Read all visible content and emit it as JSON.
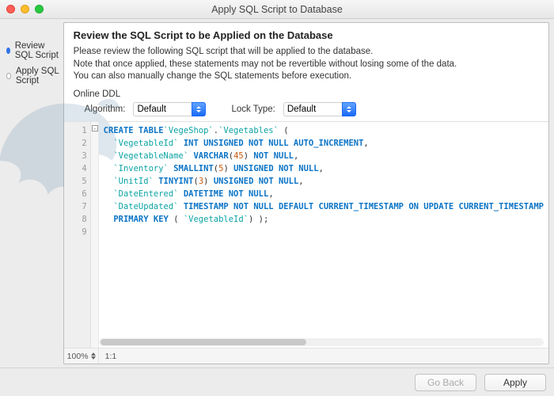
{
  "window": {
    "title": "Apply SQL Script to Database"
  },
  "sidebar": {
    "steps": [
      {
        "label": "Review SQL Script",
        "status": "active"
      },
      {
        "label": "Apply SQL Script",
        "status": "pending"
      }
    ]
  },
  "header": {
    "title": "Review the SQL Script to be Applied on the Database"
  },
  "description": {
    "line1": "Please review the following SQL script that will be applied to the database.",
    "line2": "Note that once applied, these statements may not be revertible without losing some of the data.",
    "line3": "You can also manually change the SQL statements before execution."
  },
  "ddl": {
    "section_label": "Online DDL",
    "algorithm_label": "Algorithm:",
    "algorithm_value": "Default",
    "lock_label": "Lock Type:",
    "lock_value": "Default"
  },
  "sql": {
    "lines": [
      {
        "n": 1,
        "tokens": [
          [
            "kw",
            "CREATE TABLE"
          ],
          [
            "",
            ""
          ],
          [
            "id",
            "`VegeShop`"
          ],
          [
            "",
            "."
          ],
          [
            "id",
            "`Vegetables`"
          ],
          [
            "",
            " ("
          ]
        ]
      },
      {
        "n": 2,
        "tokens": [
          [
            "",
            "  "
          ],
          [
            "id",
            "`VegetableId`"
          ],
          [
            "",
            " "
          ],
          [
            "ty",
            "INT UNSIGNED NOT NULL AUTO_INCREMENT"
          ],
          [
            "",
            ","
          ]
        ]
      },
      {
        "n": 3,
        "tokens": [
          [
            "",
            "  "
          ],
          [
            "id",
            "`VegetableName`"
          ],
          [
            "",
            " "
          ],
          [
            "ty",
            "VARCHAR"
          ],
          [
            "",
            "("
          ],
          [
            "num",
            "45"
          ],
          [
            "",
            ") "
          ],
          [
            "ty",
            "NOT NULL"
          ],
          [
            "",
            ","
          ]
        ]
      },
      {
        "n": 4,
        "tokens": [
          [
            "",
            "  "
          ],
          [
            "id",
            "`Inventory`"
          ],
          [
            "",
            " "
          ],
          [
            "ty",
            "SMALLINT"
          ],
          [
            "",
            "("
          ],
          [
            "num",
            "5"
          ],
          [
            "",
            ") "
          ],
          [
            "ty",
            "UNSIGNED NOT NULL"
          ],
          [
            "",
            ","
          ]
        ]
      },
      {
        "n": 5,
        "tokens": [
          [
            "",
            "  "
          ],
          [
            "id",
            "`UnitId`"
          ],
          [
            "",
            " "
          ],
          [
            "ty",
            "TINYINT"
          ],
          [
            "",
            "("
          ],
          [
            "num",
            "3"
          ],
          [
            "",
            ") "
          ],
          [
            "ty",
            "UNSIGNED NOT NULL"
          ],
          [
            "",
            ","
          ]
        ]
      },
      {
        "n": 6,
        "tokens": [
          [
            "",
            "  "
          ],
          [
            "id",
            "`DateEntered`"
          ],
          [
            "",
            " "
          ],
          [
            "ty",
            "DATETIME NOT NULL"
          ],
          [
            "",
            ","
          ]
        ]
      },
      {
        "n": 7,
        "tokens": [
          [
            "",
            "  "
          ],
          [
            "id",
            "`DateUpdated`"
          ],
          [
            "",
            " "
          ],
          [
            "ty",
            "TIMESTAMP NOT NULL DEFAULT CURRENT_TIMESTAMP ON UPDATE CURRENT_TIMESTAMP"
          ]
        ]
      },
      {
        "n": 8,
        "tokens": [
          [
            "",
            "  "
          ],
          [
            "kw",
            "PRIMARY KEY"
          ],
          [
            "",
            " ( "
          ],
          [
            "id",
            "`VegetableId`"
          ],
          [
            "",
            ") );"
          ]
        ]
      },
      {
        "n": 9,
        "tokens": [
          [
            "",
            ""
          ]
        ]
      }
    ]
  },
  "status": {
    "zoom": "100%",
    "ratio": "1:1"
  },
  "footer": {
    "back": "Go Back",
    "apply": "Apply"
  }
}
